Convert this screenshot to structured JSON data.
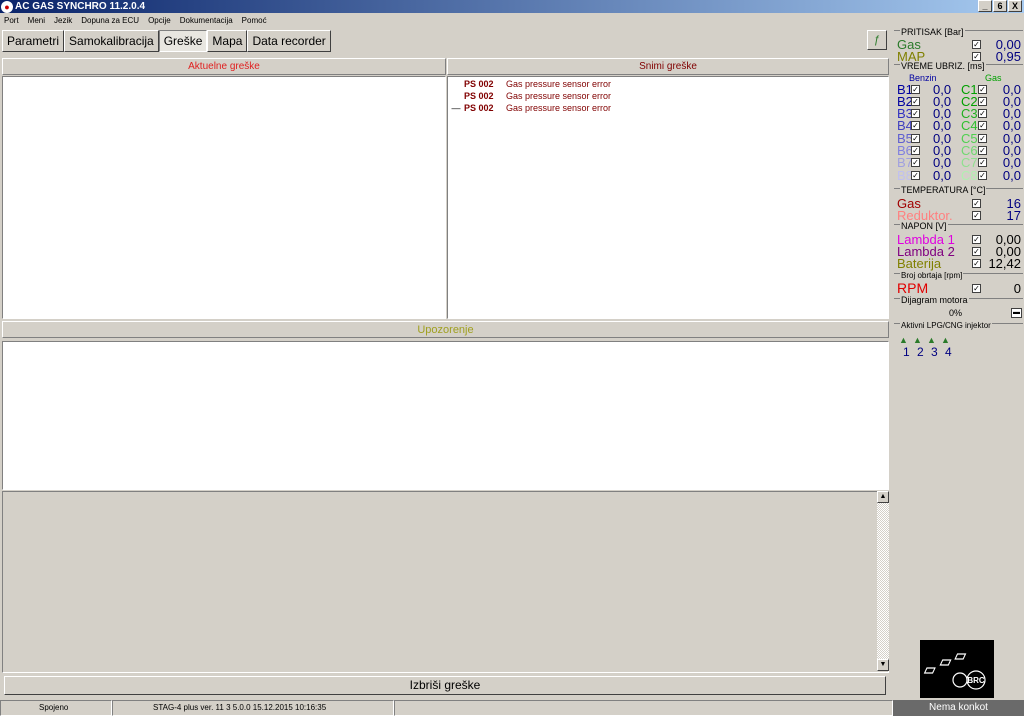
{
  "window": {
    "title": "AC GAS SYNCHRO  11.2.0.4",
    "buttons": [
      "_",
      "6",
      "X"
    ]
  },
  "menu": [
    "Port",
    "Meni",
    "Jezik",
    "Dopuna za ECU",
    "Opcije",
    "Dokumentacija",
    "Pomoć"
  ],
  "tabs": [
    "Parametri",
    "Samokalibracija",
    "Greške",
    "Mapa",
    "Data recorder"
  ],
  "active_tab": "Greške",
  "right_button": "ƒ",
  "panels": {
    "active_errors_title": "Aktuelne greške",
    "saved_errors_title": "Snimi greške",
    "warnings_title": "Upozorenje"
  },
  "saved_errors": [
    {
      "mark": "",
      "code": "PS 002",
      "text": "Gas pressure sensor error"
    },
    {
      "mark": "",
      "code": "PS 002",
      "text": "Gas pressure sensor error"
    },
    {
      "mark": "—",
      "code": "PS 002",
      "text": "Gas pressure sensor error"
    }
  ],
  "delete_button": "Izbriši greške",
  "status": {
    "connection": "Spojeno",
    "info": "STAG-4 plus  ver. 11 3  5.0.0   15.12.2015 10:16:35"
  },
  "side": {
    "pressure": {
      "title": "PRITISAK [Bar]",
      "rows": [
        {
          "label": "Gas",
          "value": "0,00",
          "color": "#2a7a2a"
        },
        {
          "label": "MAP",
          "value": "0,95",
          "color": "#808000"
        }
      ]
    },
    "injection": {
      "title": "VREME UBRIZ. [ms]",
      "col_benzin": "Benzin",
      "col_gas": "Gas",
      "rows": [
        {
          "b": "B1",
          "bv": "0,0",
          "c": "C1",
          "cv": "0,0",
          "bcolor": "#0000a0",
          "ccolor": "#00a000"
        },
        {
          "b": "B2",
          "bv": "0,0",
          "c": "C2",
          "cv": "0,0",
          "bcolor": "#0000a0",
          "ccolor": "#00a000"
        },
        {
          "b": "B3",
          "bv": "0,0",
          "c": "C3",
          "cv": "0,0",
          "bcolor": "#3030c0",
          "ccolor": "#20b020"
        },
        {
          "b": "B4",
          "bv": "0,0",
          "c": "C4",
          "cv": "0,0",
          "bcolor": "#4040c0",
          "ccolor": "#30c030"
        },
        {
          "b": "B5",
          "bv": "0,0",
          "c": "C5",
          "cv": "0,0",
          "bcolor": "#6060d0",
          "ccolor": "#50d050"
        },
        {
          "b": "B6",
          "bv": "0,0",
          "c": "C6",
          "cv": "0,0",
          "bcolor": "#8080e0",
          "ccolor": "#70d870"
        },
        {
          "b": "B7",
          "bv": "0,0",
          "c": "C7",
          "cv": "0,0",
          "bcolor": "#a0a0e0",
          "ccolor": "#90e090"
        },
        {
          "b": "B8",
          "bv": "0,0",
          "c": "C8",
          "cv": "0,0",
          "bcolor": "#c0c0f0",
          "ccolor": "#b0f0b0"
        }
      ]
    },
    "temperature": {
      "title": "TEMPERATURA [°C]",
      "rows": [
        {
          "label": "Gas",
          "value": "16",
          "color": "#a00000"
        },
        {
          "label": "Reduktor.",
          "value": "17",
          "color": "#ff8080"
        }
      ]
    },
    "voltage": {
      "title": "NAPON [V]",
      "rows": [
        {
          "label": "Lambda 1",
          "value": "0,00",
          "color": "#e000e0"
        },
        {
          "label": "Lambda 2",
          "value": "0,00",
          "color": "#800080"
        },
        {
          "label": "Baterija",
          "value": "12,42",
          "color": "#808000"
        }
      ]
    },
    "rpm": {
      "title": "Broj obrtaja [rpm]",
      "label": "RPM",
      "value": "0",
      "color": "#e00000"
    },
    "engine": {
      "title": "Dijagram motora",
      "value": "0%"
    },
    "injectors": {
      "title": "Aktivni LPG/CNG injektor",
      "numbers": [
        "1",
        "2",
        "3",
        "4"
      ]
    },
    "logo_label": "Nema konkot"
  }
}
